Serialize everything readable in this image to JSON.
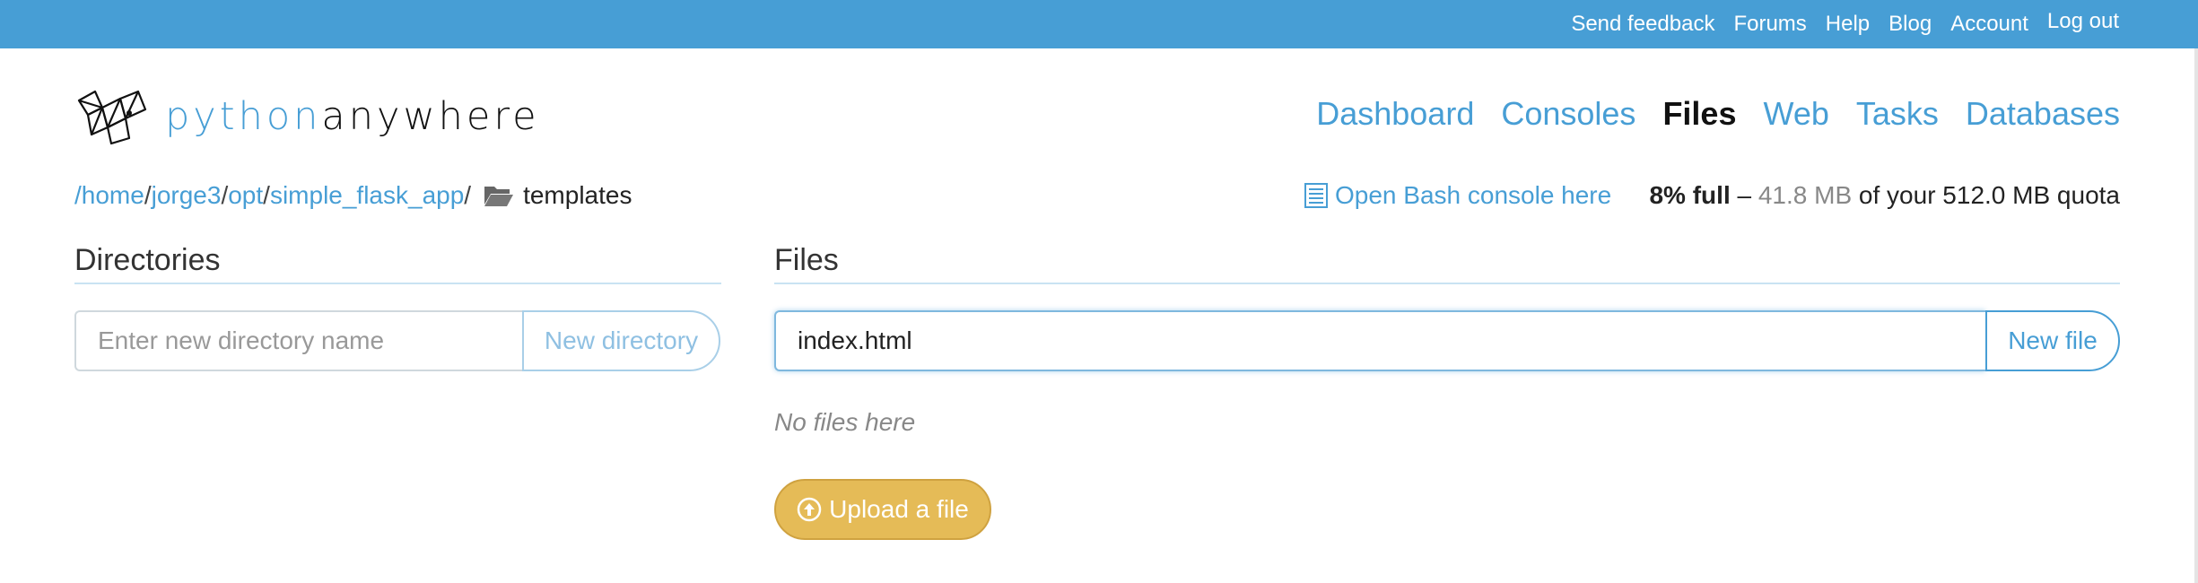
{
  "topbar": {
    "links": [
      "Send feedback",
      "Forums",
      "Help",
      "Blog",
      "Account"
    ],
    "logout": "Log out"
  },
  "logo": {
    "part1": "python",
    "part2": "anywhere"
  },
  "nav": {
    "items": [
      "Dashboard",
      "Consoles",
      "Files",
      "Web",
      "Tasks",
      "Databases"
    ],
    "active": "Files"
  },
  "breadcrumb": {
    "root": "/",
    "parts": [
      "home",
      "jorge3",
      "opt",
      "simple_flask_app"
    ],
    "current": "templates"
  },
  "bash_link": "Open Bash console here",
  "quota": {
    "percent": "8% full",
    "dash": " – ",
    "used": "41.8 MB",
    "rest": " of your 512.0 MB quota"
  },
  "directories": {
    "title": "Directories",
    "placeholder": "Enter new directory name",
    "button": "New directory"
  },
  "files": {
    "title": "Files",
    "input_value": "index.html",
    "button": "New file",
    "empty_text": "No files here",
    "upload_button": "Upload a file"
  },
  "colors": {
    "brand_blue": "#479ed5",
    "upload_yellow": "#e5bb57"
  }
}
